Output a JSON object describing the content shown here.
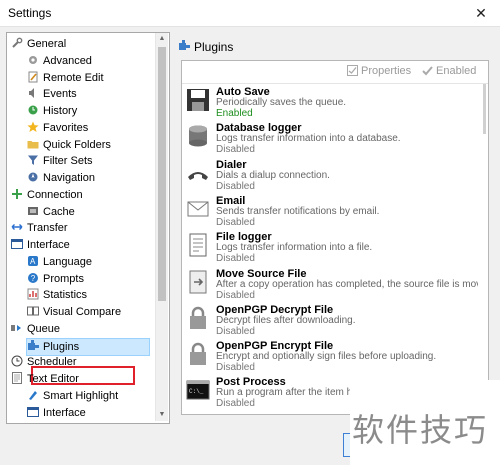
{
  "window": {
    "title": "Settings",
    "close_glyph": "✕"
  },
  "tree": {
    "items": [
      {
        "label": "General",
        "icon": "wrench-icon",
        "name": "general"
      },
      {
        "label": "Advanced",
        "icon": "gear-icon",
        "name": "advanced"
      },
      {
        "label": "Remote Edit",
        "icon": "edit-icon",
        "name": "remote-edit"
      },
      {
        "label": "Events",
        "icon": "speaker-icon",
        "name": "events"
      },
      {
        "label": "History",
        "icon": "history-icon",
        "name": "history"
      },
      {
        "label": "Favorites",
        "icon": "star-icon",
        "name": "favorites"
      },
      {
        "label": "Quick Folders",
        "icon": "folder-icon",
        "name": "quick-folders"
      },
      {
        "label": "Filter Sets",
        "icon": "filter-icon",
        "name": "filter-sets"
      },
      {
        "label": "Navigation",
        "icon": "navigation-icon",
        "name": "navigation"
      },
      {
        "label": "Connection",
        "icon": "connection-icon",
        "name": "connection"
      },
      {
        "label": "Cache",
        "icon": "cache-icon",
        "name": "cache"
      },
      {
        "label": "Transfer",
        "icon": "transfer-icon",
        "name": "transfer"
      },
      {
        "label": "Interface",
        "icon": "interface-icon",
        "name": "interface"
      },
      {
        "label": "Language",
        "icon": "language-icon",
        "name": "language"
      },
      {
        "label": "Prompts",
        "icon": "prompt-icon",
        "name": "prompts"
      },
      {
        "label": "Statistics",
        "icon": "statistics-icon",
        "name": "statistics"
      },
      {
        "label": "Visual Compare",
        "icon": "compare-icon",
        "name": "visual-compare"
      },
      {
        "label": "Queue",
        "icon": "queue-icon",
        "name": "queue"
      },
      {
        "label": "Plugins",
        "icon": "plugin-icon",
        "name": "plugins"
      },
      {
        "label": "Scheduler",
        "icon": "clock-icon",
        "name": "scheduler"
      },
      {
        "label": "Text Editor",
        "icon": "text-editor-icon",
        "name": "text-editor"
      },
      {
        "label": "Smart Highlight",
        "icon": "highlight-icon",
        "name": "smart-highlight"
      },
      {
        "label": "Interface",
        "icon": "interface-icon",
        "name": "text-editor-interface"
      }
    ]
  },
  "panel": {
    "title": "Plugins",
    "toolbar": {
      "properties": "Properties",
      "enabled": "Enabled"
    },
    "plugins": [
      {
        "name": "Auto Save",
        "desc": "Periodically saves the queue.",
        "status": "Enabled",
        "icon": "save-icon",
        "enabled": true
      },
      {
        "name": "Database logger",
        "desc": "Logs transfer information into a database.",
        "status": "Disabled",
        "icon": "database-icon",
        "enabled": false
      },
      {
        "name": "Dialer",
        "desc": "Dials a dialup connection.",
        "status": "Disabled",
        "icon": "phone-icon",
        "enabled": false
      },
      {
        "name": "Email",
        "desc": "Sends transfer notifications by email.",
        "status": "Disabled",
        "icon": "email-icon",
        "enabled": false
      },
      {
        "name": "File logger",
        "desc": "Logs transfer information into a file.",
        "status": "Disabled",
        "icon": "file-log-icon",
        "enabled": false
      },
      {
        "name": "Move Source File",
        "desc": "After a copy operation has completed, the source file is moved…",
        "status": "Disabled",
        "icon": "move-file-icon",
        "enabled": false
      },
      {
        "name": "OpenPGP Decrypt File",
        "desc": "Decrypt files after downloading.",
        "status": "Disabled",
        "icon": "lock-icon",
        "enabled": false
      },
      {
        "name": "OpenPGP Encrypt File",
        "desc": "Encrypt and optionally sign files before uploading.",
        "status": "Disabled",
        "icon": "lock-icon",
        "enabled": false
      },
      {
        "name": "Post Process",
        "desc": "Run a program after the item has been processed.",
        "status": "Disabled",
        "icon": "terminal-icon",
        "enabled": false
      }
    ]
  },
  "watermark": {
    "text": "软件技巧"
  },
  "colors": {
    "accent": "#1e8e1e",
    "selection": "#cce8ff",
    "highlight": "#e0202a"
  }
}
